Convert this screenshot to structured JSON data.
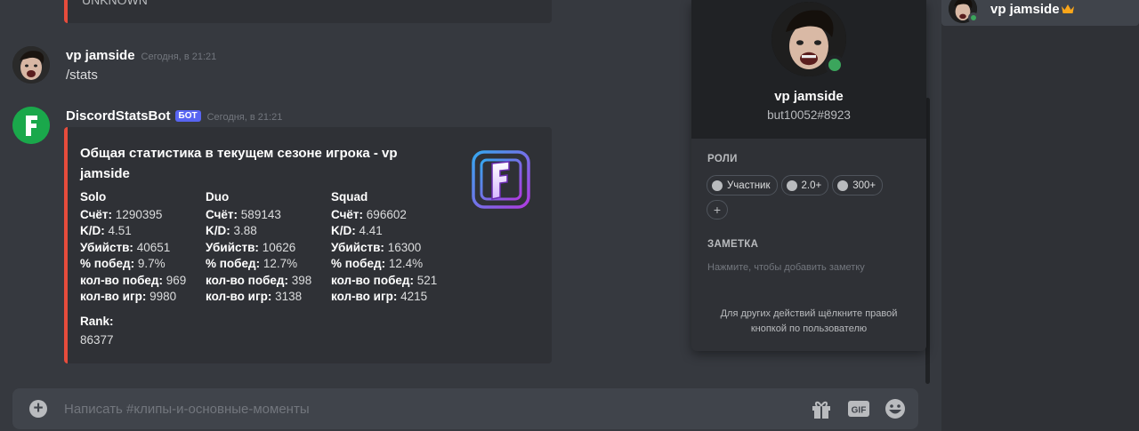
{
  "previous_embed": {
    "text": "UNKNOWN"
  },
  "user_message": {
    "author": "vp jamside",
    "timestamp": "Сегодня, в 21:21",
    "text": "/stats"
  },
  "bot_message": {
    "author": "DiscordStatsBot",
    "badge": "БОТ",
    "timestamp": "Сегодня, в 21:21",
    "embed": {
      "accent_color": "#e74c3c",
      "title": "Общая статистика в текущем сезоне игрока - vp jamside",
      "thumbnail_icon": "fortnite-logo-icon",
      "modes": [
        {
          "name": "Solo",
          "score_label": "Счёт:",
          "score": "1290395",
          "kd_label": "K/D:",
          "kd": "4.51",
          "kills_label": "Убийств:",
          "kills": "40651",
          "winrate_label": "% побед:",
          "winrate": "9.7%",
          "wins_label": "кол-во побед:",
          "wins": "969",
          "games_label": "кол-во игр:",
          "games": "9980"
        },
        {
          "name": "Duo",
          "score_label": "Счёт:",
          "score": "589143",
          "kd_label": "K/D:",
          "kd": "3.88",
          "kills_label": "Убийств:",
          "kills": "10626",
          "winrate_label": "% побед:",
          "winrate": "12.7%",
          "wins_label": "кол-во побед:",
          "wins": "398",
          "games_label": "кол-во игр:",
          "games": "3138"
        },
        {
          "name": "Squad",
          "score_label": "Счёт:",
          "score": "696602",
          "kd_label": "K/D:",
          "kd": "4.41",
          "kills_label": "Убийств:",
          "kills": "16300",
          "winrate_label": "% побед:",
          "winrate": "12.4%",
          "wins_label": "кол-во побед:",
          "wins": "521",
          "games_label": "кол-во игр:",
          "games": "4215"
        }
      ],
      "rank_label": "Rank:",
      "rank": "86377"
    }
  },
  "composer": {
    "placeholder": "Написать #клипы-и-основные-моменты",
    "icons": [
      "plus-circle-icon",
      "gift-icon",
      "gif-icon",
      "emoji-icon"
    ],
    "gif_label": "GIF"
  },
  "profile_popout": {
    "name": "vp jamside",
    "tag": "but10052#8923",
    "status_color": "#3ba55c",
    "roles_heading": "РОЛИ",
    "roles": [
      "Участник",
      "2.0+",
      "300+"
    ],
    "add_role": "+",
    "note_heading": "ЗАМЕТКА",
    "note_placeholder": "Нажмите, чтобы добавить заметку",
    "hint": "Для других действий щёлкните правой кнопкой по пользователю"
  },
  "member_list": {
    "items": [
      {
        "name": "vp jamside",
        "owner_icon": "crown-icon",
        "status": "online"
      }
    ]
  }
}
